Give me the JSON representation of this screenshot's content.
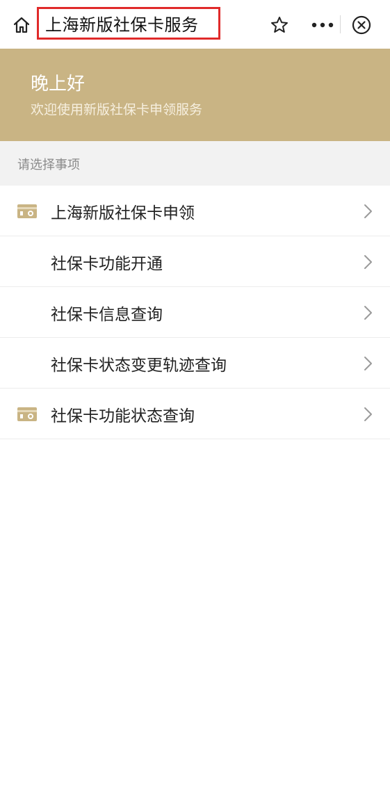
{
  "header": {
    "title": "上海新版社保卡服务",
    "icons": {
      "home": "home-icon",
      "favorite": "star-icon",
      "more": "more-dots-icon",
      "close": "close-circle-icon"
    },
    "highlight_color": "#e02a2a"
  },
  "banner": {
    "greeting": "晚上好",
    "welcome": "欢迎使用新版社保卡申领服务",
    "background_color": "#c9b484"
  },
  "section": {
    "label": "请选择事项"
  },
  "menu": {
    "items": [
      {
        "label": "上海新版社保卡申领",
        "icon": "card-icon"
      },
      {
        "label": "社保卡功能开通",
        "icon": null
      },
      {
        "label": "社保卡信息查询",
        "icon": null
      },
      {
        "label": "社保卡状态变更轨迹查询",
        "icon": null
      },
      {
        "label": "社保卡功能状态查询",
        "icon": "card-icon"
      }
    ]
  }
}
